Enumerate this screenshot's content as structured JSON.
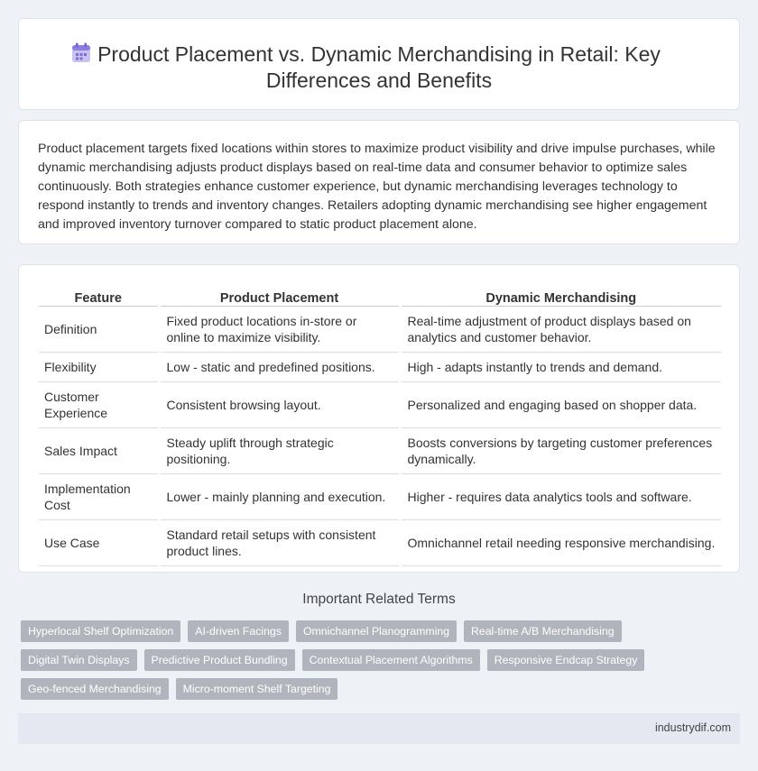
{
  "header": {
    "icon": "calendar-icon",
    "title": "Product Placement vs. Dynamic Merchandising in Retail: Key Differences and Benefits"
  },
  "intro": "Product placement targets fixed locations within stores to maximize product visibility and drive impulse purchases, while dynamic merchandising adjusts product displays based on real-time data and consumer behavior to optimize sales continuously. Both strategies enhance customer experience, but dynamic merchandising leverages technology to respond instantly to trends and inventory changes. Retailers adopting dynamic merchandising see higher engagement and improved inventory turnover compared to static product placement alone.",
  "table": {
    "headers": [
      "Feature",
      "Product Placement",
      "Dynamic Merchandising"
    ],
    "rows": [
      [
        "Definition",
        "Fixed product locations in-store or online to maximize visibility.",
        "Real-time adjustment of product displays based on analytics and customer behavior."
      ],
      [
        "Flexibility",
        "Low - static and predefined positions.",
        "High - adapts instantly to trends and demand."
      ],
      [
        "Customer Experience",
        "Consistent browsing layout.",
        "Personalized and engaging based on shopper data."
      ],
      [
        "Sales Impact",
        "Steady uplift through strategic positioning.",
        "Boosts conversions by targeting customer preferences dynamically."
      ],
      [
        "Implementation Cost",
        "Lower - mainly planning and execution.",
        "Higher - requires data analytics tools and software."
      ],
      [
        "Use Case",
        "Standard retail setups with consistent product lines.",
        "Omnichannel retail needing responsive merchandising."
      ]
    ]
  },
  "related": {
    "title": "Important Related Terms",
    "tags": [
      "Hyperlocal Shelf Optimization",
      "AI-driven Facings",
      "Omnichannel Planogramming",
      "Real-time A/B Merchandising",
      "Digital Twin Displays",
      "Predictive Product Bundling",
      "Contextual Placement Algorithms",
      "Responsive Endcap Strategy",
      "Geo-fenced Merchandising",
      "Micro-moment Shelf Targeting"
    ]
  },
  "footer": {
    "site": "industrydif.com"
  }
}
